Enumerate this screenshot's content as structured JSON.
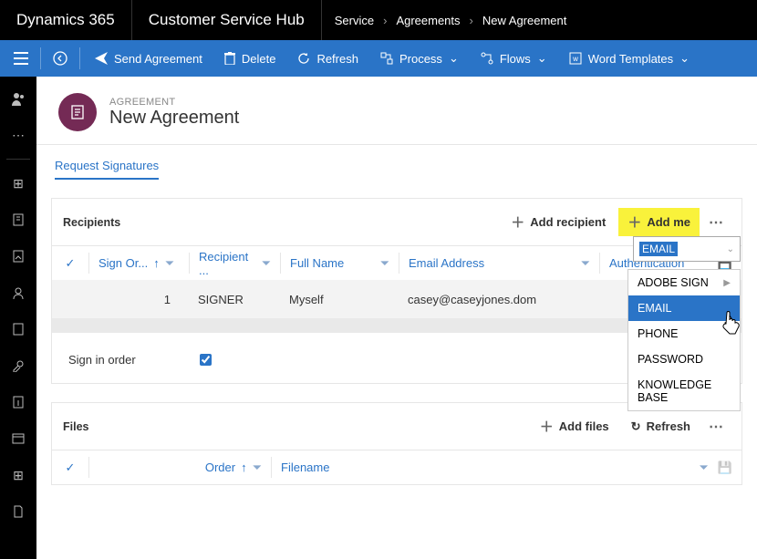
{
  "brand": "Dynamics 365",
  "app": "Customer Service Hub",
  "breadcrumb": [
    "Service",
    "Agreements",
    "New Agreement"
  ],
  "commands": {
    "send": "Send Agreement",
    "delete": "Delete",
    "refresh": "Refresh",
    "process": "Process",
    "flows": "Flows",
    "wordTemplates": "Word Templates"
  },
  "record": {
    "entityLabel": "AGREEMENT",
    "title": "New Agreement"
  },
  "tabs": {
    "active": "Request Signatures"
  },
  "recipients": {
    "title": "Recipients",
    "addRecipient": "Add recipient",
    "addMe": "Add me",
    "columns": {
      "signOrder": "Sign Or...",
      "recipientRole": "Recipient ...",
      "fullName": "Full Name",
      "email": "Email Address",
      "authentication": "Authentication"
    },
    "rows": [
      {
        "order": "1",
        "role": "SIGNER",
        "fullName": "Myself",
        "email": "casey@caseyjones.dom",
        "auth": "EMAIL"
      }
    ],
    "signInOrderLabel": "Sign in order",
    "signInOrderChecked": true
  },
  "authDropdown": {
    "selected": "EMAIL",
    "options": [
      "ADOBE SIGN",
      "EMAIL",
      "PHONE",
      "PASSWORD",
      "KNOWLEDGE BASE"
    ]
  },
  "files": {
    "title": "Files",
    "addFiles": "Add files",
    "refresh": "Refresh",
    "columns": {
      "order": "Order",
      "filename": "Filename"
    }
  }
}
